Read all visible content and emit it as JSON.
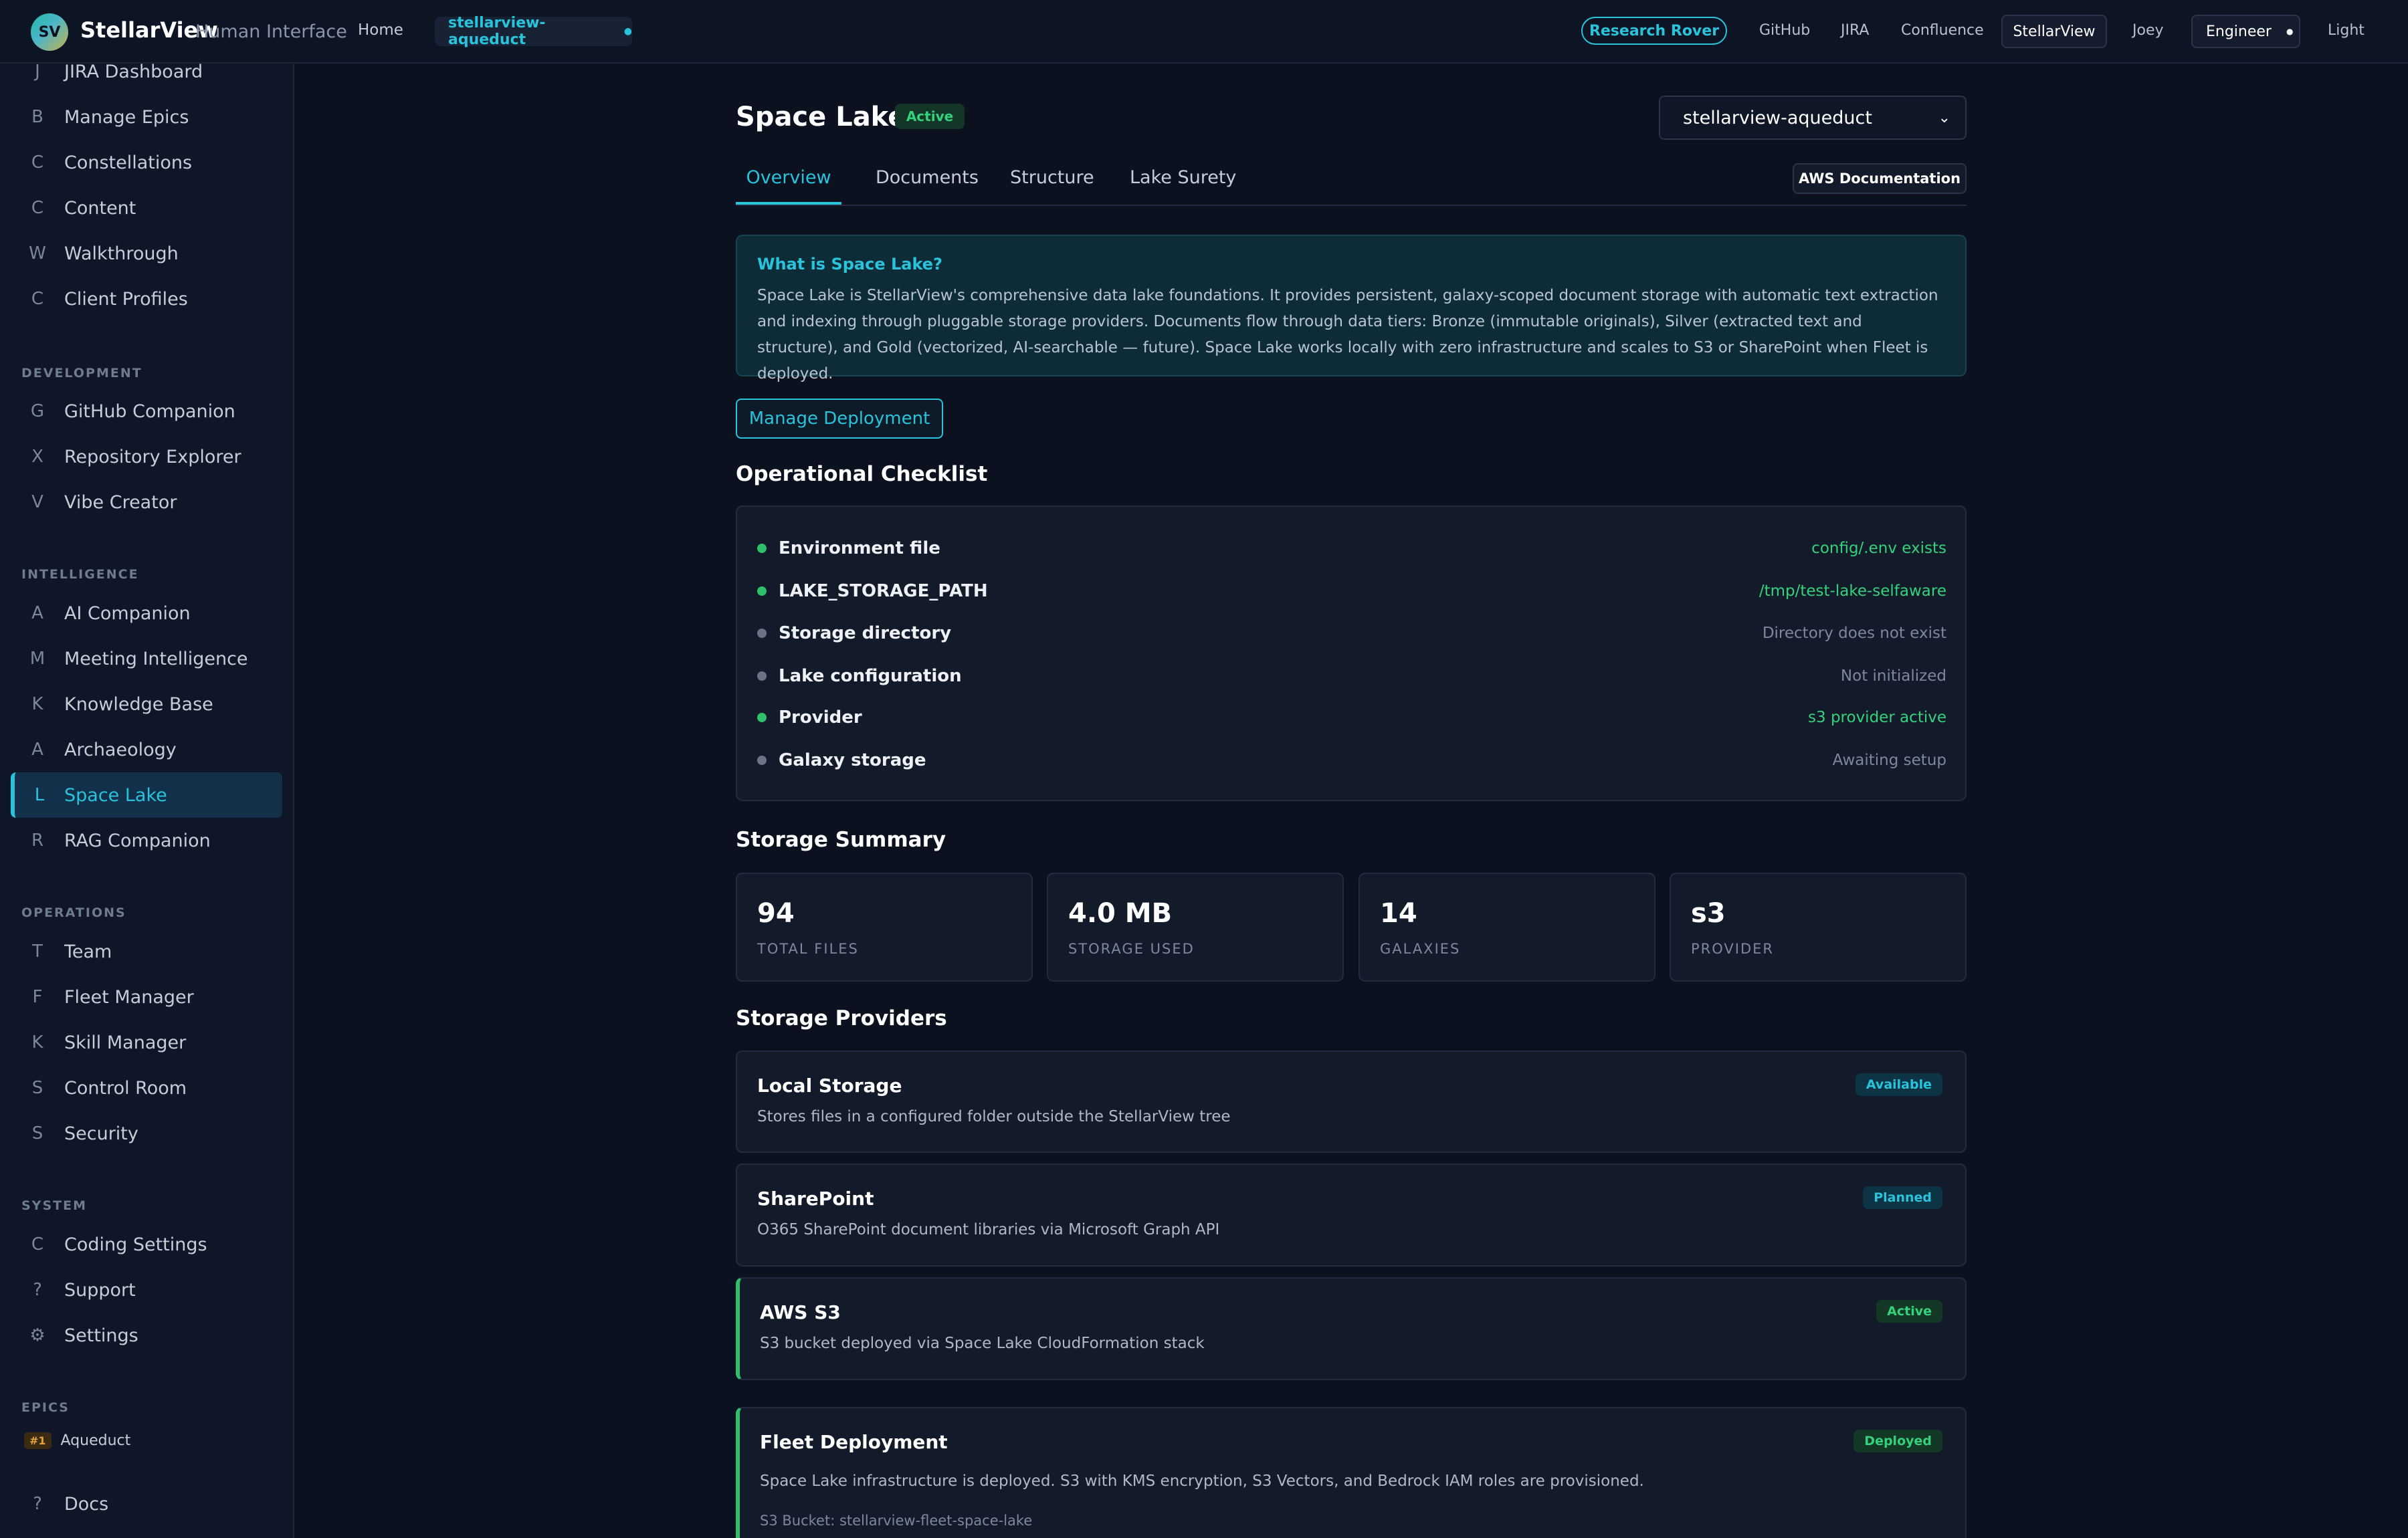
{
  "topbar": {
    "logo_initials": "SV",
    "brand": "StellarView",
    "brand_sub": "Human Interface",
    "home": "Home",
    "project": "stellarview-aqueduct",
    "research_button": "Research Rover",
    "links": [
      "GitHub",
      "JIRA",
      "Confluence"
    ],
    "active_link": "StellarView",
    "user": "Joey",
    "role": "Engineer",
    "theme": "Light"
  },
  "sidebar": {
    "top_items": [
      {
        "letter": "J",
        "label": "JIRA Dashboard"
      },
      {
        "letter": "B",
        "label": "Manage Epics"
      },
      {
        "letter": "C",
        "label": "Constellations"
      },
      {
        "letter": "C",
        "label": "Content"
      },
      {
        "letter": "W",
        "label": "Walkthrough"
      },
      {
        "letter": "C",
        "label": "Client Profiles"
      }
    ],
    "sections": {
      "development": "DEVELOPMENT",
      "intelligence": "INTELLIGENCE",
      "operations": "OPERATIONS",
      "system": "SYSTEM",
      "epics": "EPICS"
    },
    "development": [
      {
        "letter": "G",
        "label": "GitHub Companion"
      },
      {
        "letter": "X",
        "label": "Repository Explorer"
      },
      {
        "letter": "V",
        "label": "Vibe Creator"
      }
    ],
    "intelligence": [
      {
        "letter": "A",
        "label": "AI Companion"
      },
      {
        "letter": "M",
        "label": "Meeting Intelligence"
      },
      {
        "letter": "K",
        "label": "Knowledge Base"
      },
      {
        "letter": "A",
        "label": "Archaeology"
      },
      {
        "letter": "L",
        "label": "Space Lake"
      },
      {
        "letter": "R",
        "label": "RAG Companion"
      }
    ],
    "operations": [
      {
        "letter": "T",
        "label": "Team"
      },
      {
        "letter": "F",
        "label": "Fleet Manager"
      },
      {
        "letter": "K",
        "label": "Skill Manager"
      },
      {
        "letter": "S",
        "label": "Control Room"
      },
      {
        "letter": "S",
        "label": "Security"
      }
    ],
    "system": [
      {
        "letter": "C",
        "label": "Coding Settings"
      },
      {
        "letter": "?",
        "label": "Support"
      },
      {
        "letter": "⚙",
        "label": "Settings"
      }
    ],
    "epic": {
      "badge": "#1",
      "label": "Aqueduct"
    },
    "docs": {
      "letter": "?",
      "label": "Docs"
    }
  },
  "page": {
    "title": "Space Lake",
    "status": "Active",
    "deployment": "stellarview-aqueduct",
    "tabs": [
      "Overview",
      "Documents",
      "Structure",
      "Lake Surety"
    ],
    "aws_doc": "AWS Documentation",
    "info_title": "What is Space Lake?",
    "info_text": "Space Lake is StellarView's comprehensive data lake foundations. It provides persistent, galaxy-scoped document storage with automatic text extraction and indexing through pluggable storage providers. Documents flow through data tiers: Bronze (immutable originals), Silver (extracted text and structure), and Gold (vectorized, AI-searchable — future). Space Lake works locally with zero infrastructure and scales to S3 or SharePoint when Fleet is deployed.",
    "manage_button": "Manage Deployment",
    "checklist_title": "Operational Checklist",
    "checklist": [
      {
        "name": "Environment file",
        "value": "config/.env exists",
        "ok": true
      },
      {
        "name": "LAKE_STORAGE_PATH",
        "value": "/tmp/test-lake-selfaware",
        "ok": true
      },
      {
        "name": "Storage directory",
        "value": "Directory does not exist",
        "ok": false
      },
      {
        "name": "Lake configuration",
        "value": "Not initialized",
        "ok": false
      },
      {
        "name": "Provider",
        "value": "s3 provider active",
        "ok": true
      },
      {
        "name": "Galaxy storage",
        "value": "Awaiting setup",
        "ok": false
      }
    ],
    "summary_title": "Storage Summary",
    "stats": [
      {
        "value": "94",
        "label": "TOTAL FILES"
      },
      {
        "value": "4.0 MB",
        "label": "STORAGE USED"
      },
      {
        "value": "14",
        "label": "GALAXIES"
      },
      {
        "value": "s3",
        "label": "PROVIDER"
      }
    ],
    "providers_title": "Storage Providers",
    "providers": [
      {
        "title": "Local Storage",
        "desc": "Stores files in a configured folder outside the StellarView tree",
        "badge": "Available"
      },
      {
        "title": "SharePoint",
        "desc": "O365 SharePoint document libraries via Microsoft Graph API",
        "badge": "Planned"
      },
      {
        "title": "AWS S3",
        "desc": "S3 bucket deployed via Space Lake CloudFormation stack",
        "badge": "Active"
      }
    ],
    "fleet": {
      "title": "Fleet Deployment",
      "badge": "Deployed",
      "desc": "Space Lake infrastructure is deployed. S3 with KMS encryption, S3 Vectors, and Bedrock IAM roles are provisioned.",
      "bucket": "S3 Bucket: stellarview-fleet-space-lake"
    }
  },
  "colors": {
    "accent": "#29c3dc",
    "ok": "#2fbf6a",
    "pending": "#6b7385",
    "background": "#0c1120"
  }
}
